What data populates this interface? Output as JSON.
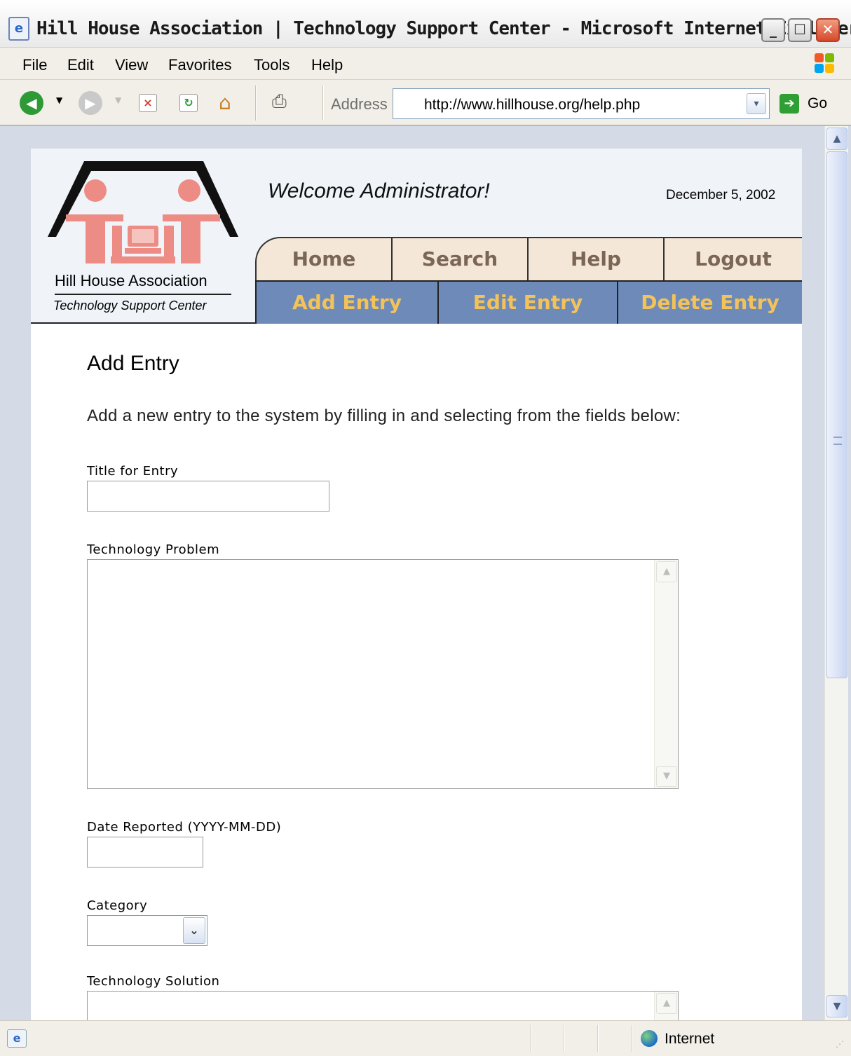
{
  "window": {
    "title": "Hill House Association | Technology Support Center - Microsoft Internet Explorer",
    "minimize": "_",
    "maximize": "☐",
    "close": "✕"
  },
  "menu": [
    "File",
    "Edit",
    "View",
    "Favorites",
    "Tools",
    "Help"
  ],
  "toolbar": {
    "address_label": "Address",
    "url": "http://www.hillhouse.org/help.php",
    "go_label": "Go"
  },
  "header": {
    "org_name": "Hill House Association",
    "org_tagline": "Technology Support Center",
    "welcome": "Welcome Administrator!",
    "date": "December 5, 2002",
    "nav_primary": [
      "Home",
      "Search",
      "Help",
      "Logout"
    ],
    "nav_secondary": [
      "Add Entry",
      "Edit Entry",
      "Delete Entry"
    ]
  },
  "form": {
    "heading": "Add Entry",
    "intro": "Add a new entry to the system by filling in and selecting from the fields below:",
    "title_label": "Title for Entry",
    "title_value": "",
    "problem_label": "Technology Problem",
    "date_label": "Date Reported (YYYY-MM-DD)",
    "date_value": "",
    "category_label": "Category",
    "category_value": "",
    "solution_label": "Technology Solution"
  },
  "status": {
    "zone": "Internet"
  },
  "colors": {
    "nav_primary_bg": "#f4e7d7",
    "nav_primary_text": "#7b6655",
    "nav_secondary_bg": "#6d8ab8",
    "nav_secondary_text": "#f3c35a",
    "logo_figures": "#ec8c84"
  }
}
